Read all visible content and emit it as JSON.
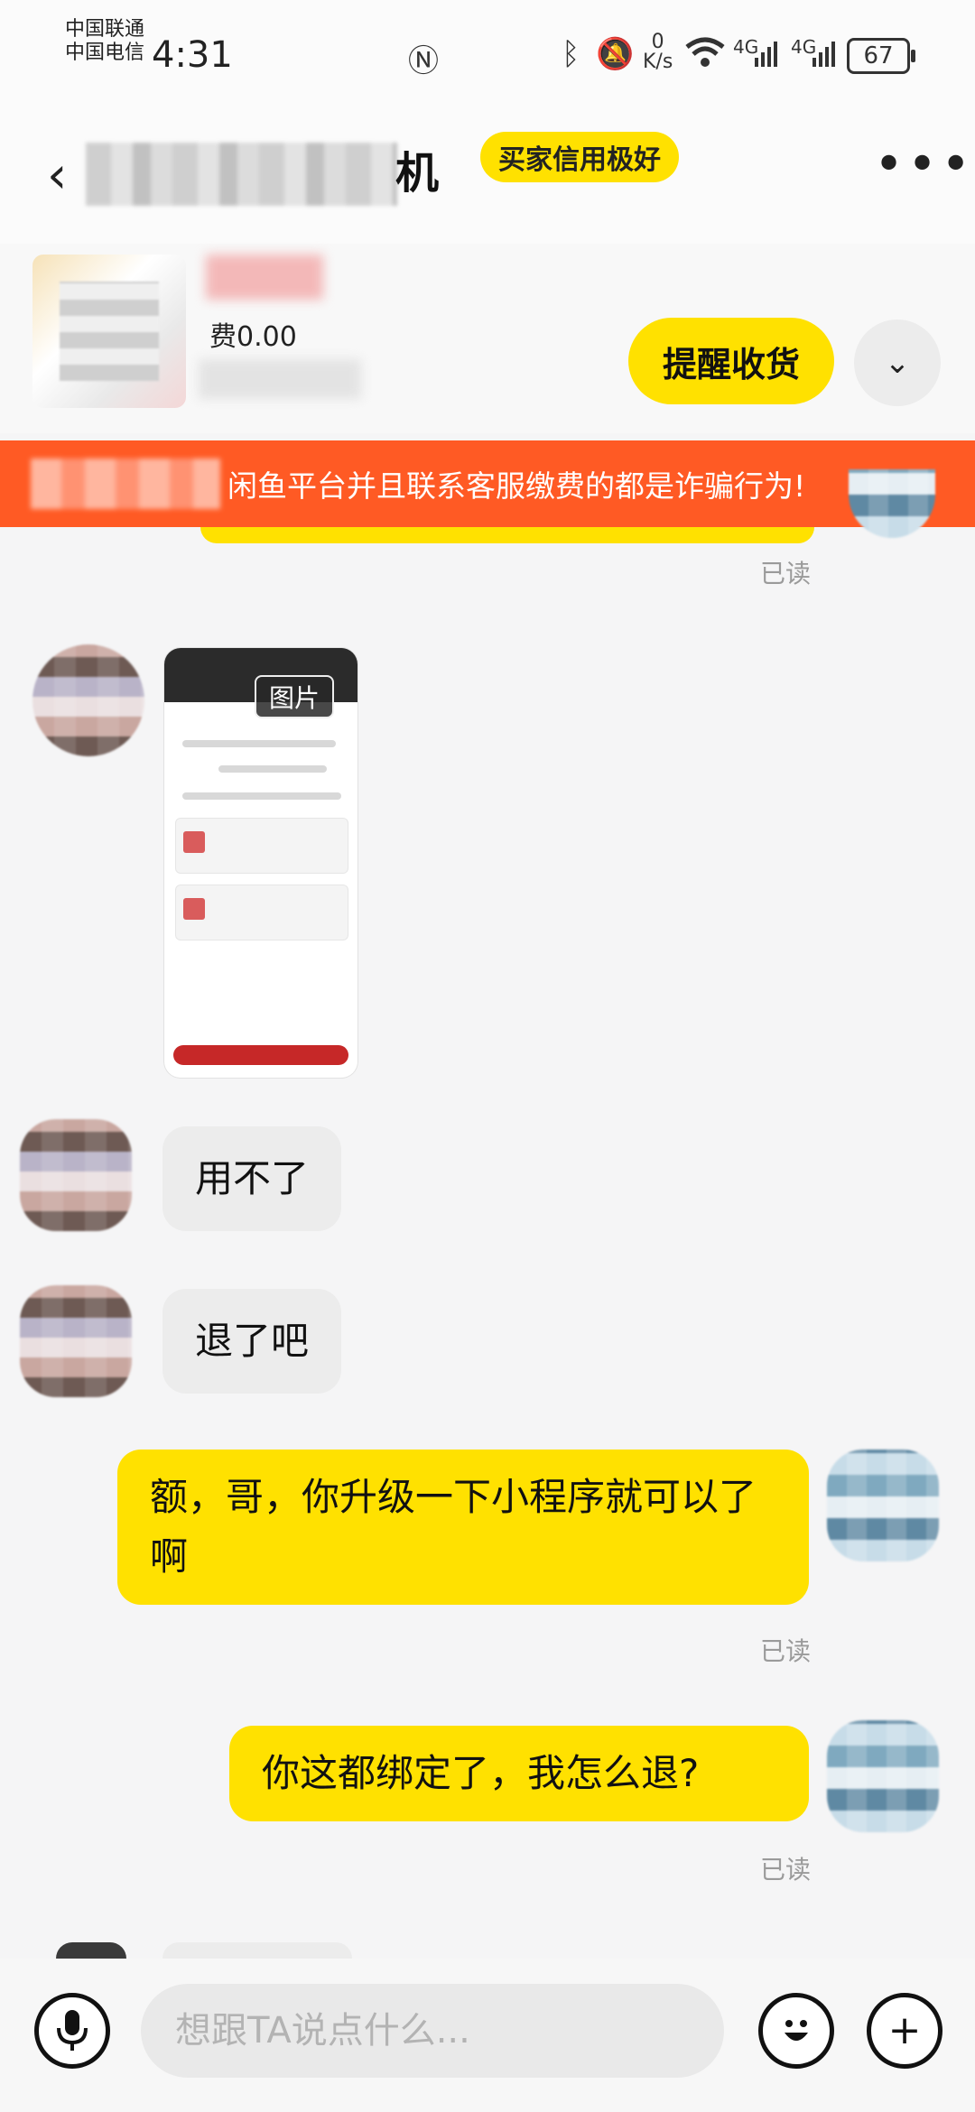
{
  "status_bar": {
    "carrier1": "中国联通",
    "carrier2": "中国电信",
    "time": "4:31",
    "net_speed": "0",
    "net_unit": "K/s",
    "signal1": "4G",
    "signal2": "4G",
    "battery": "67"
  },
  "header": {
    "back_icon": "chevron-left-icon",
    "title": "机",
    "badge": "买家信用极好",
    "more_icon": "more-icon"
  },
  "order": {
    "fee": "费0.00",
    "remind_button": "提醒收货",
    "expand_icon": "chevron-down-icon"
  },
  "warning": {
    "text": "闲鱼平台并且联系客服缴费的都是诈骗行为!"
  },
  "messages": [
    {
      "side": "right",
      "status": "已读"
    },
    {
      "side": "left",
      "type": "image",
      "label": "图片"
    },
    {
      "side": "left",
      "text": "用不了"
    },
    {
      "side": "left",
      "text": "退了吧"
    },
    {
      "side": "right",
      "text": "额，哥，你升级一下小程序就可以了啊",
      "status": "已读"
    },
    {
      "side": "right",
      "text": "你这都绑定了，我怎么退?",
      "status": "已读"
    }
  ],
  "input_bar": {
    "placeholder": "想跟TA说点什么...",
    "voice_icon": "microphone-icon",
    "emoji_icon": "emoji-icon",
    "add_icon": "plus-icon"
  }
}
